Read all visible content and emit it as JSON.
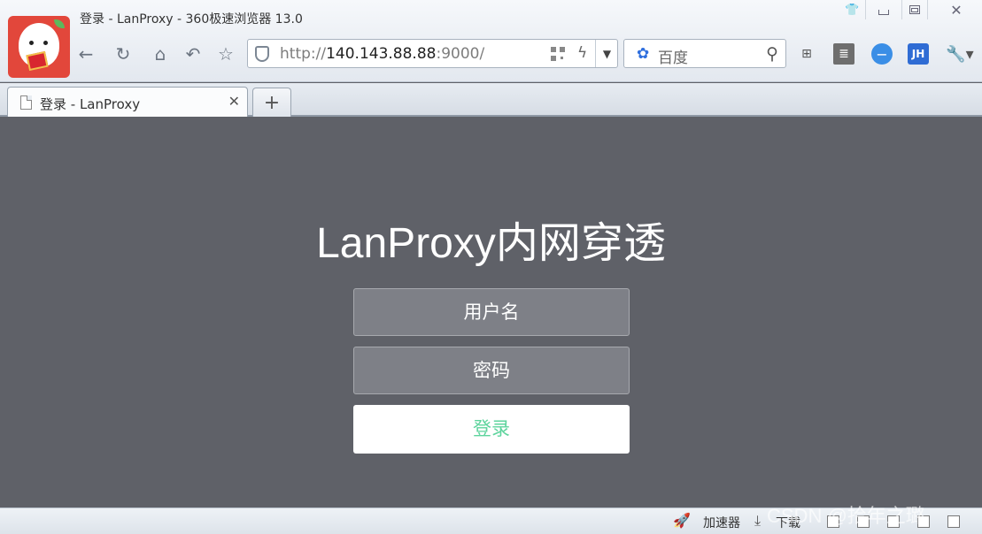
{
  "window": {
    "title": "登录 - LanProxy - 360极速浏览器 13.0"
  },
  "toolbar": {
    "back_icon": "back-arrow-icon",
    "refresh_icon": "refresh-icon",
    "home_icon": "home-icon",
    "undo_icon": "undo-icon",
    "favorite_icon": "star-icon",
    "url_prefix": "http://",
    "url_host": "140.143.88.88",
    "url_suffix": ":9000/",
    "search_engine": "百度",
    "extension_icons": [
      "extensions-icon",
      "notes-icon",
      "blue-circle-icon",
      "jh-icon",
      "wrench-icon"
    ],
    "jh_label": "JH"
  },
  "tabs": [
    {
      "label": "登录 - LanProxy",
      "active": true
    }
  ],
  "new_tab_label": "+",
  "page": {
    "title": "LanProxy内网穿透",
    "username_placeholder": "用户名",
    "password_placeholder": "密码",
    "login_label": "登录",
    "background_color": "#5f6168",
    "accent_color": "#5ed49d"
  },
  "status_bar": {
    "accelerator_label": "加速器",
    "download_label": "下载"
  },
  "watermark": "CSDN @拾年之璐"
}
